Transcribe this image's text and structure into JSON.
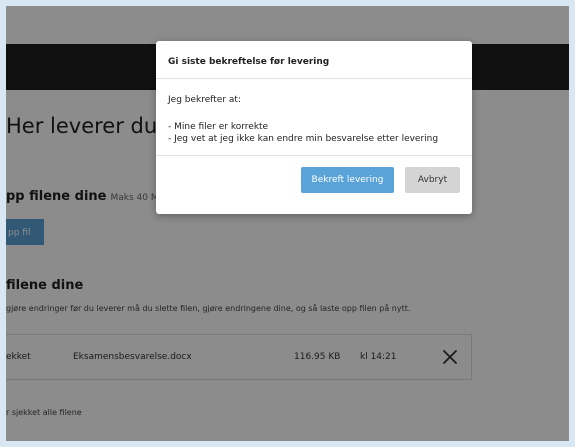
{
  "page": {
    "title": "Her leverer du filer",
    "upload": {
      "heading": "pp filene dine",
      "limit": "Maks 40 MB pr",
      "button_label": "pp fil"
    },
    "files": {
      "heading": "filene dine",
      "help": "gjøre endringer før du leverer må du slette filen, gjøre endringene dine, og så laste opp filen på nytt.",
      "rows": [
        {
          "status": "ekket",
          "name": "Eksamensbesvarelse.docx",
          "size": "116.95 KB",
          "time": "kl 14:21",
          "delete_icon": "close-icon"
        }
      ]
    },
    "footer_note": "r sjekket alle filene"
  },
  "dialog": {
    "title": "Gi siste bekreftelse før levering",
    "intro": "Jeg bekrefter at:",
    "items": [
      "- Mine filer er korrekte",
      "- Jeg vet at jeg ikke kan endre min besvarelse etter levering"
    ],
    "confirm_label": "Bekreft levering",
    "cancel_label": "Avbryt"
  },
  "colors": {
    "accent": "#5aa3d8",
    "topbar": "#1f1f1f",
    "frame": "#d8e7f2",
    "cancel_bg": "#d4d4d4"
  }
}
